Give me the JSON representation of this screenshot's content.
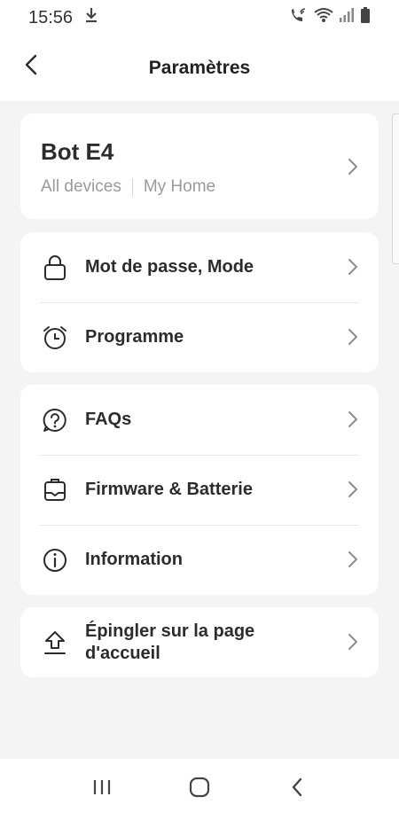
{
  "status_bar": {
    "time": "15:56",
    "icons": [
      "download-icon",
      "wifi-calling-icon",
      "wifi-icon",
      "signal-icon",
      "battery-icon"
    ]
  },
  "header": {
    "title": "Paramètres",
    "back_icon": "chevron-left-icon"
  },
  "device": {
    "name": "Bot E4",
    "location": "All devices",
    "room": "My Home"
  },
  "groups": [
    {
      "items": [
        {
          "label": "Mot de passe, Mode",
          "icon": "lock-icon"
        },
        {
          "label": "Programme",
          "icon": "alarm-clock-icon"
        }
      ]
    },
    {
      "items": [
        {
          "label": "FAQs",
          "icon": "question-icon"
        },
        {
          "label": "Firmware & Batterie",
          "icon": "firmware-icon"
        },
        {
          "label": "Information",
          "icon": "info-icon"
        }
      ]
    },
    {
      "items": [
        {
          "label": "Épingler sur la page\nd'accueil",
          "icon": "pin-upload-icon"
        }
      ]
    }
  ],
  "colors": {
    "background": "#f4f4f5",
    "card": "#ffffff",
    "text": "#2c2c30",
    "muted": "#9a9a9e"
  },
  "nav_bar": {
    "icons": [
      "recent-apps-icon",
      "home-icon",
      "back-icon"
    ]
  }
}
